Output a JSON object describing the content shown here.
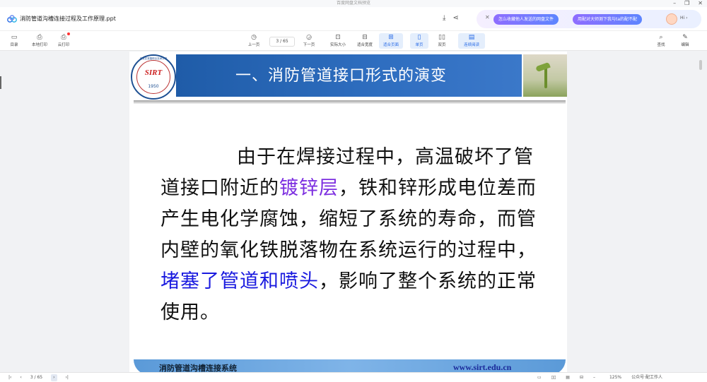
{
  "window": {
    "title": "百度网盘文档预览",
    "minimize": "–",
    "restore": "❐",
    "close": "✕"
  },
  "doc": {
    "name": "消防管道沟槽连接过程及工作原理.ppt",
    "download_icon": "⤓",
    "share_icon": "⋖"
  },
  "ai": {
    "close": "✕",
    "chip1": "怎么收藏他人发送的网盘文件",
    "chip2": "用配对大师测下我与ta的配不配",
    "hi": "Hi ›"
  },
  "toolbar": {
    "catalog": "目录",
    "local_print": "本地打印",
    "cloud_print": "云打印",
    "prev": "上一页",
    "page_indicator": "3 / 65",
    "next": "下一页",
    "actual_size": "实际大小",
    "fit_width": "适合宽度",
    "fit_page": "适合页面",
    "single": "单页",
    "double": "双页",
    "continuous": "连续阅读",
    "search": "查找",
    "annotate": "编辑"
  },
  "slide": {
    "title": "一、消防管道接口形式的演变",
    "logo_text": "石家庄铁路职业技术学院",
    "logo_mark": "SIRT",
    "logo_year": "1950",
    "p1": "由于在焊接过程中，高温破坏了管道接口附近的",
    "hl1": "镀锌层",
    "p2": "，铁和锌形成电位差而产生电化学腐蚀，缩短了系统的寿命，而管内壁的氧化铁脱落物在系统运行的过程中，",
    "hl2": "堵塞了管道和喷头",
    "p3": "，影响了整个系统的正常使用。",
    "footer_left": "消防管道沟槽连接系统",
    "footer_right": "www.sirt.edu.cn"
  },
  "status": {
    "first": "|‹",
    "prev": "‹",
    "page": "3 / 65",
    "next": "›",
    "last": "›|",
    "zoom": "125%",
    "brand": "公众号·配工作人"
  },
  "colors": {
    "accent": "#2b6de6",
    "banner": "#2f6ec0",
    "highlight_purple": "#7d2fe0",
    "highlight_blue": "#1a1adf"
  }
}
